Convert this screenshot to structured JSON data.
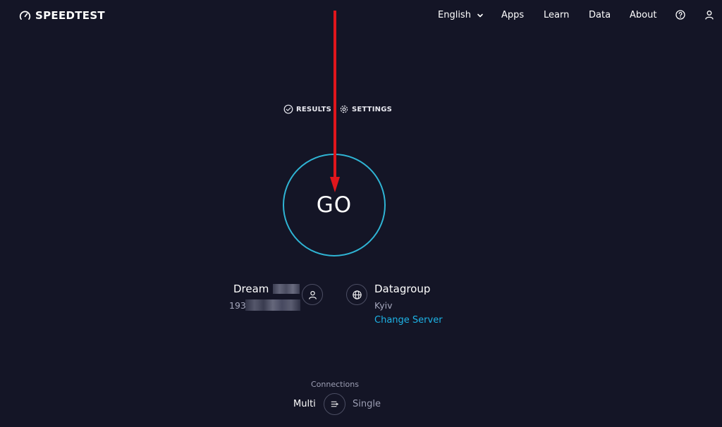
{
  "header": {
    "logo_text": "SPEEDTEST",
    "language": "English",
    "nav": [
      "Apps",
      "Learn",
      "Data",
      "About"
    ]
  },
  "tools": {
    "results": "RESULTS",
    "settings": "SETTINGS"
  },
  "go_button": {
    "label": "GO"
  },
  "isp": {
    "name": "Dream",
    "ip": "193."
  },
  "server": {
    "name": "Datagroup",
    "location": "Kyiv",
    "change_link": "Change Server"
  },
  "connections": {
    "title": "Connections",
    "multi": "Multi",
    "single": "Single"
  },
  "colors": {
    "background": "#141526",
    "accent_ring": "#2fb4d4",
    "link": "#1db3e6",
    "annotation_arrow": "#e0161c"
  },
  "icons": {
    "logo": "speedometer-icon",
    "results": "check-circle-icon",
    "settings": "gear-icon",
    "help": "help-circle-icon",
    "account": "user-icon",
    "isp": "user-icon",
    "server": "globe-icon",
    "connections": "connections-icon"
  }
}
